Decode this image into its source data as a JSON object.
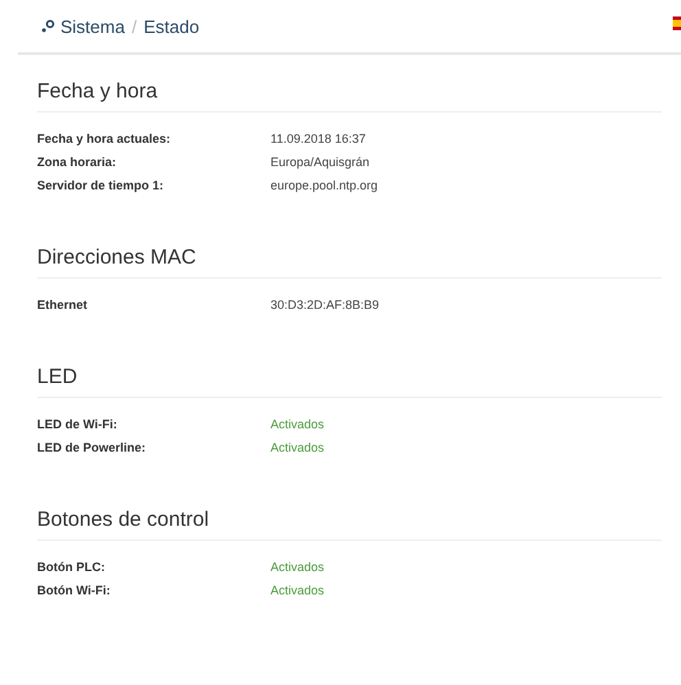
{
  "breadcrumb": {
    "parent": "Sistema",
    "separator": "/",
    "current": "Estado"
  },
  "sections": [
    {
      "title": "Fecha y hora",
      "rows": [
        {
          "label": "Fecha y hora actuales:",
          "value": "11.09.2018 16:37",
          "kind": "plain"
        },
        {
          "label": "Zona horaria:",
          "value": "Europa/Aquisgrán",
          "kind": "plain"
        },
        {
          "label": "Servidor de tiempo 1:",
          "value": "europe.pool.ntp.org",
          "kind": "plain"
        }
      ]
    },
    {
      "title": "Direcciones MAC",
      "rows": [
        {
          "label": "Ethernet",
          "value": "30:D3:2D:AF:8B:B9",
          "kind": "plain"
        }
      ]
    },
    {
      "title": "LED",
      "rows": [
        {
          "label": "LED de Wi-Fi:",
          "value": "Activados",
          "kind": "status"
        },
        {
          "label": "LED de Powerline:",
          "value": "Activados",
          "kind": "status"
        }
      ]
    },
    {
      "title": "Botones de control",
      "rows": [
        {
          "label": "Botón PLC:",
          "value": "Activados",
          "kind": "status"
        },
        {
          "label": "Botón Wi-Fi:",
          "value": "Activados",
          "kind": "status"
        }
      ]
    }
  ]
}
